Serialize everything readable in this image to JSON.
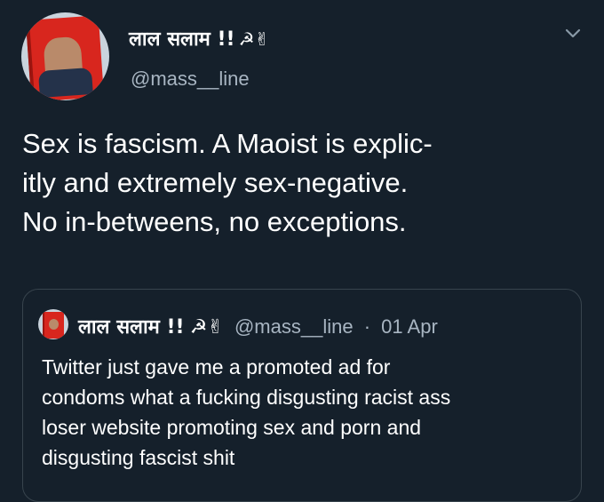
{
  "tweet": {
    "display_name": "लाल सलाम !!",
    "emoji": "☭✌",
    "handle": "@mass__line",
    "body_lines": [
      "Sex is fascism. A Maoist is explic-",
      "itly and extremely sex-negative.",
      "No in-betweens, no exceptions."
    ],
    "menu_icon": "chevron-down-icon"
  },
  "quoted_tweet": {
    "display_name": "लाल सलाम !!",
    "emoji": "☭✌",
    "handle": "@mass__line",
    "separator": "·",
    "date": "01 Apr",
    "body_lines": [
      "Twitter just gave me a promoted ad for",
      "condoms what a fucking disgusting racist ass",
      "loser website promoting sex and porn and",
      "disgusting fascist shit"
    ]
  },
  "colors": {
    "background": "#15202b",
    "text": "#ffffff",
    "secondary_text": "#a8b5c2",
    "border": "#38444d"
  }
}
